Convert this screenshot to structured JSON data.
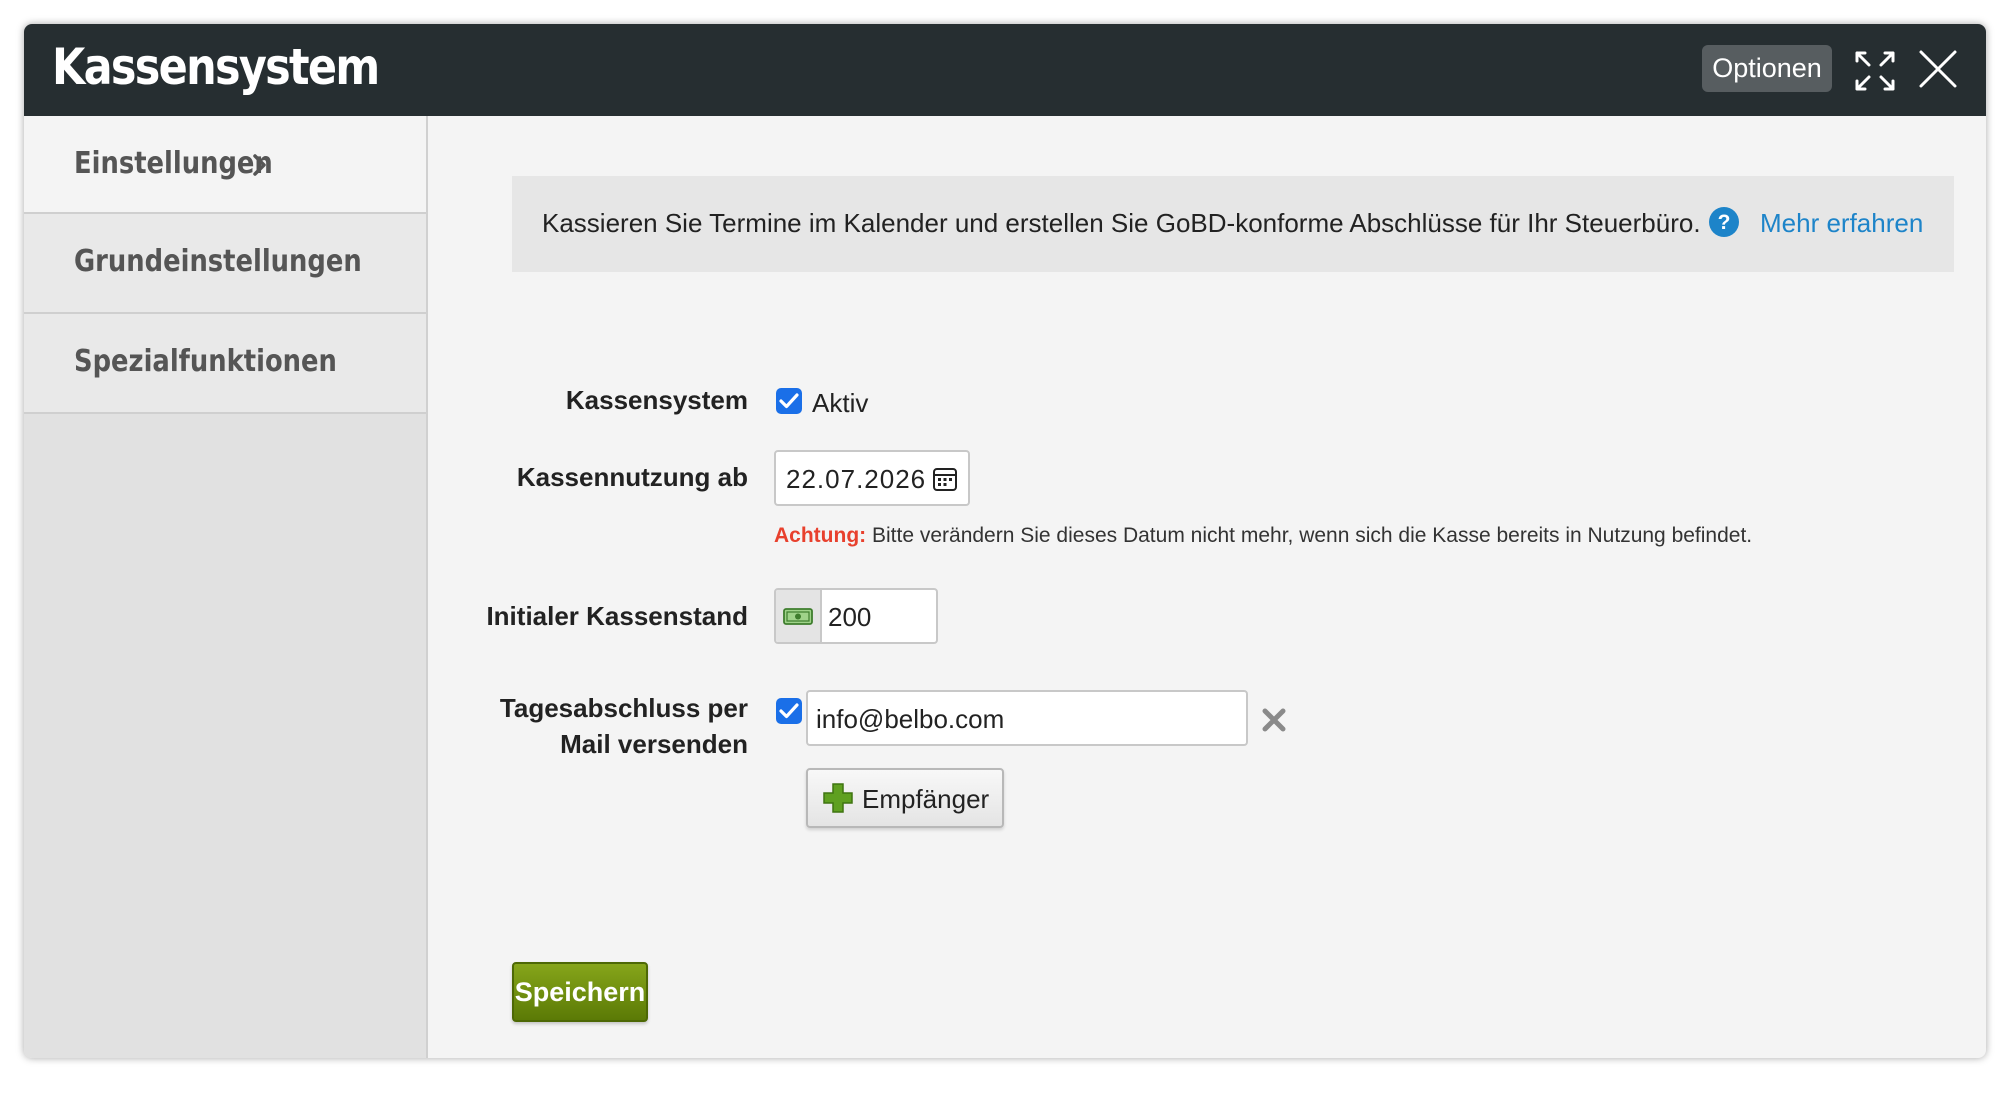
{
  "window": {
    "title": "Kassensystem",
    "options_label": "Optionen"
  },
  "sidebar": {
    "items": [
      {
        "label": "Einstellungen"
      },
      {
        "label": "Grundeinstellungen"
      },
      {
        "label": "Spezialfunktionen"
      }
    ]
  },
  "info": {
    "text": "Kassieren Sie Termine im Kalender und erstellen Sie GoBD-konforme Abschlüsse für Ihr Steuerbüro.",
    "link_label": "Mehr erfahren"
  },
  "form": {
    "kassensystem": {
      "label": "Kassensystem",
      "checked": true,
      "check_label": "Aktiv"
    },
    "kassennutzung": {
      "label": "Kassennutzung ab",
      "value": "22.07.2026"
    },
    "warning": {
      "prefix": "Achtung:",
      "text": " Bitte verändern Sie dieses Datum nicht mehr, wenn sich die Kasse bereits in Nutzung befindet."
    },
    "kassenstand": {
      "label": "Initialer Kassenstand",
      "value": "200"
    },
    "tagesabschluss": {
      "label_line1": "Tagesabschluss per",
      "label_line2": "Mail versenden",
      "checked": true,
      "email": "info@belbo.com",
      "add_label": "Empfänger"
    },
    "save_label": "Speichern"
  },
  "colors": {
    "titlebar": "#262e31",
    "accent_blue": "#1d84c9",
    "checkbox": "#1a6fe8",
    "warning": "#e8402d",
    "save_green": "#6f8f10"
  },
  "icons": {
    "expand": "expand-icon",
    "close": "close-icon",
    "chevron": "chevron-right-icon",
    "help": "help-circle-icon",
    "calendar": "calendar-icon",
    "money": "banknote-icon",
    "remove": "remove-x-icon",
    "plus": "plus-icon"
  }
}
